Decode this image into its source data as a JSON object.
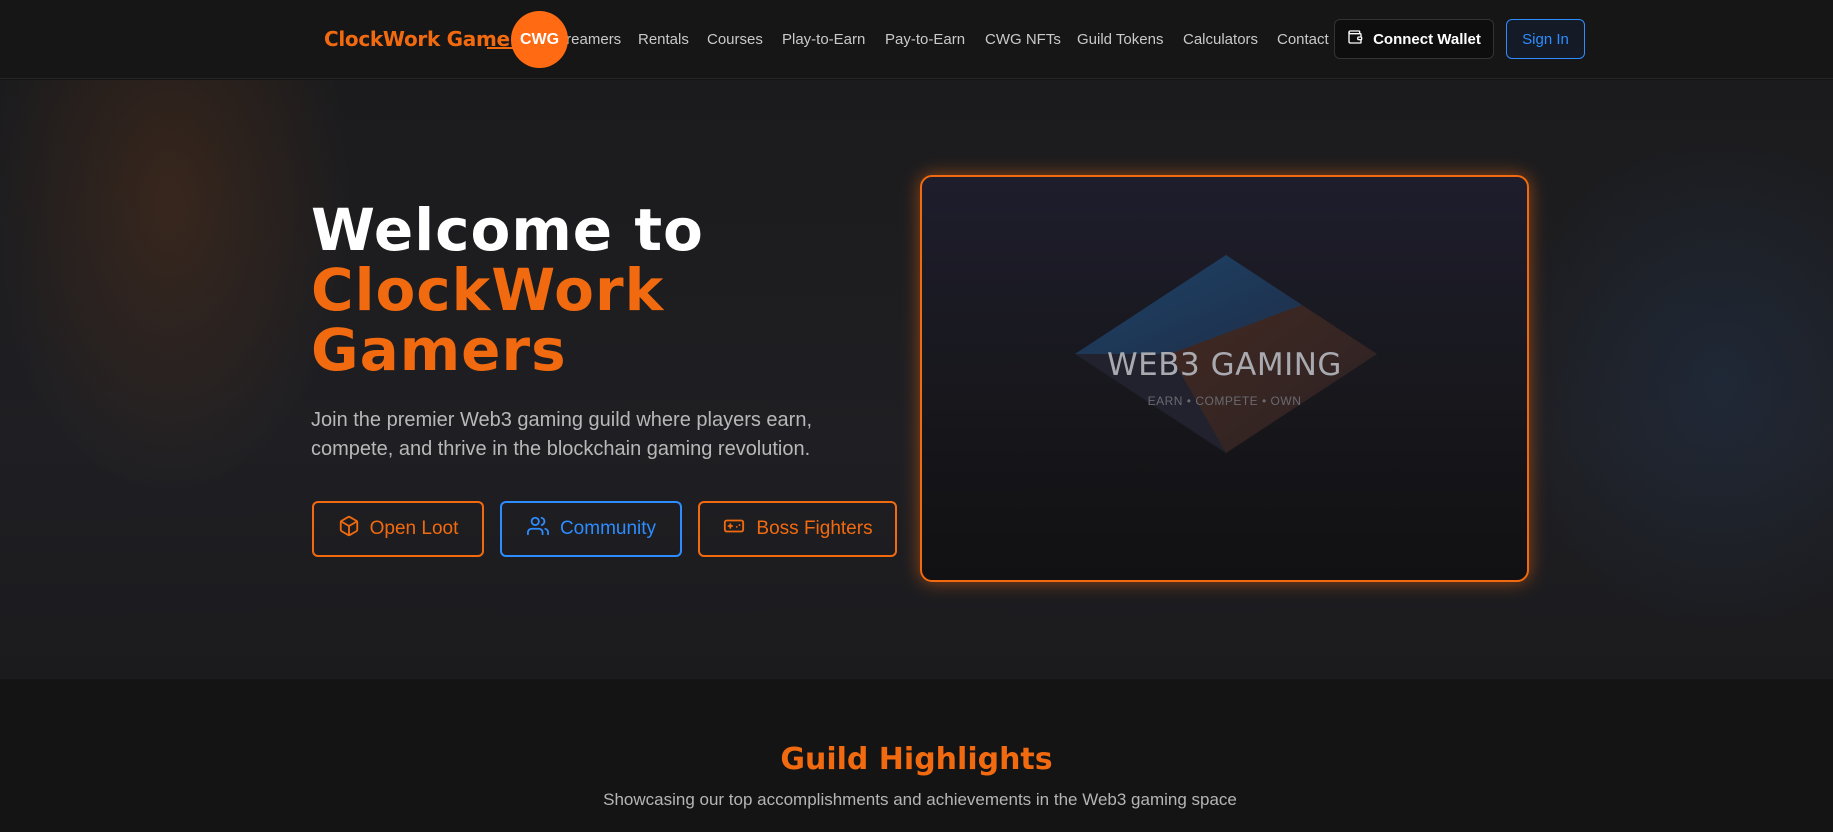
{
  "nav": {
    "brand": "ClockWork Gamers",
    "badge": "CWG",
    "links": [
      "Streamers",
      "Rentals",
      "Courses",
      "Play-to-Earn",
      "Pay-to-Earn",
      "CWG NFTs",
      "Guild Tokens",
      "Calculators",
      "Contact"
    ],
    "connect_wallet": "Connect Wallet",
    "sign_in": "Sign In",
    "wallet_icon": "wallet-icon"
  },
  "hero": {
    "title_line1": "Welcome to",
    "title_line2": "ClockWork",
    "title_line3": "Gamers",
    "description": "Join the premier Web3 gaming guild where players earn, compete, and thrive in the blockchain gaming revolution.",
    "buttons": [
      {
        "label": "Open Loot",
        "icon": "box-icon",
        "color": "#f26a0f"
      },
      {
        "label": "Community",
        "icon": "users-icon",
        "color": "#2d8cff"
      },
      {
        "label": "Boss Fighters",
        "icon": "gamepad-icon",
        "color": "#f26a0f"
      }
    ],
    "media_title": "WEB3 GAMING",
    "media_subtitle": "EARN • COMPETE • OWN"
  },
  "highlights": {
    "title": "Guild Highlights",
    "subtitle": "Showcasing our top accomplishments and achievements in the Web3 gaming space"
  },
  "colors": {
    "accent": "#f26a0f",
    "secondary": "#2d8cff",
    "background": "#141414"
  }
}
